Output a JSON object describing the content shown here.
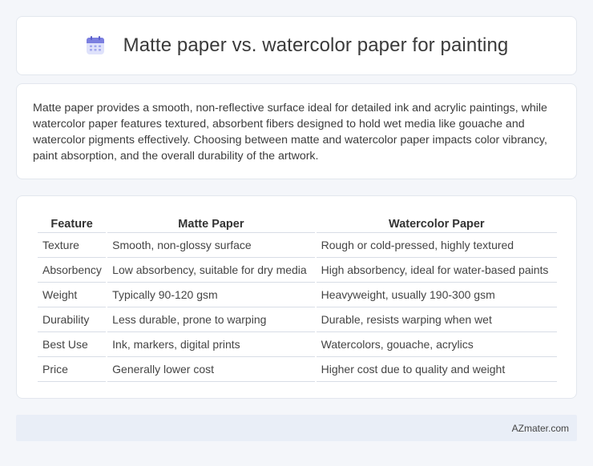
{
  "header": {
    "icon": "calendar-icon",
    "title": "Matte paper vs. watercolor paper for painting"
  },
  "intro": {
    "text": "Matte paper provides a smooth, non-reflective surface ideal for detailed ink and acrylic paintings, while watercolor paper features textured, absorbent fibers designed to hold wet media like gouache and watercolor pigments effectively. Choosing between matte and watercolor paper impacts color vibrancy, paint absorption, and the overall durability of the artwork."
  },
  "table": {
    "headers": [
      "Feature",
      "Matte Paper",
      "Watercolor Paper"
    ],
    "rows": [
      [
        "Texture",
        "Smooth, non-glossy surface",
        "Rough or cold-pressed, highly textured"
      ],
      [
        "Absorbency",
        "Low absorbency, suitable for dry media",
        "High absorbency, ideal for water-based paints"
      ],
      [
        "Weight",
        "Typically 90-120 gsm",
        "Heavyweight, usually 190-300 gsm"
      ],
      [
        "Durability",
        "Less durable, prone to warping",
        "Durable, resists warping when wet"
      ],
      [
        "Best Use",
        "Ink, markers, digital prints",
        "Watercolors, gouache, acrylics"
      ],
      [
        "Price",
        "Generally lower cost",
        "Higher cost due to quality and weight"
      ]
    ]
  },
  "footer": {
    "brand": "AZmater.com"
  },
  "colors": {
    "background": "#f4f6fa",
    "card": "#ffffff",
    "footer": "#e9eef7",
    "icon_top": "#7b7fe0",
    "icon_body": "#c9cdf5"
  }
}
